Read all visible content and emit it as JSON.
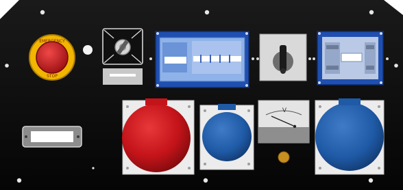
{
  "panel": {
    "colors": {
      "plate": "#0b0b0b",
      "red": "#c8161a",
      "blue": "#1f5aa6",
      "yellow": "#f2b500",
      "white": "#f2f2f2",
      "grey": "#bdbdbd"
    },
    "estop": {
      "ring_text_top": "EMERGENCY",
      "ring_text_bottom": "STOP"
    },
    "voltmeter": {
      "unit_label": "V"
    }
  }
}
